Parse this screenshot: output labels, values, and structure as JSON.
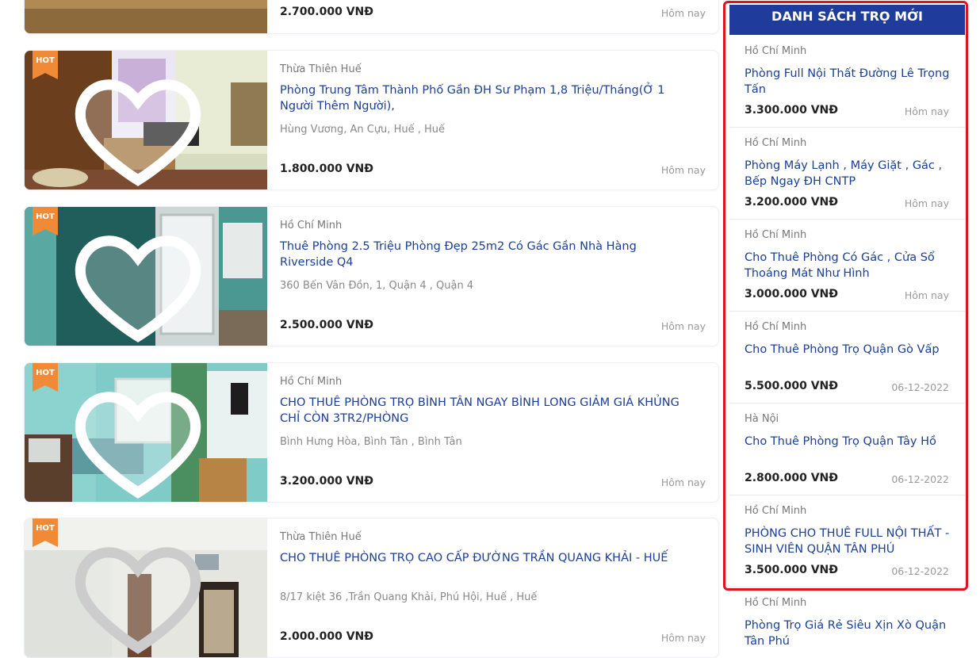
{
  "listings": [
    {
      "region": "",
      "title": "",
      "address": "",
      "price": "2.700.000 VNĐ",
      "date": "Hôm nay",
      "hot": false
    },
    {
      "region": "Thừa Thiên Huế",
      "title": "Phòng Trung Tâm Thành Phố Gần ĐH Sư Phạm 1,8 Triệu/Tháng(Ở 1 Người Thêm Người),",
      "address": "Hùng Vương, An Cựu, Huế , Huế",
      "price": "1.800.000 VNĐ",
      "date": "Hôm nay",
      "hot": true,
      "hot_label": "HOT"
    },
    {
      "region": "Hồ Chí Minh",
      "title": "Thuê Phòng 2.5 Triệu Phòng Đẹp 25m2 Có Gác Gần Nhà Hàng Riverside Q4",
      "address": "360 Bến Vân Đồn, 1, Quận 4 , Quận 4",
      "price": "2.500.000 VNĐ",
      "date": "Hôm nay",
      "hot": true,
      "hot_label": "HOT"
    },
    {
      "region": "Hồ Chí Minh",
      "title": "CHO THUÊ PHÒNG TRỌ BÌNH TÂN NGAY BÌNH LONG GIẢM GIÁ KHỦNG CHỈ CÒN 3TR2/PHÒNG",
      "address": "Bình Hưng Hòa, Bình Tân , Bình Tân",
      "price": "3.200.000 VNĐ",
      "date": "Hôm nay",
      "hot": true,
      "hot_label": "HOT"
    },
    {
      "region": "Thừa Thiên Huế",
      "title": "CHO THUÊ PHÒNG TRỌ CAO CẤP ĐƯỜNG TRẦN QUANG KHẢI - HUẾ",
      "address": "8/17 kiệt 36 ,Trần Quang Khải, Phú Hội, Huế , Huế",
      "price": "2.000.000 VNĐ",
      "date": "Hôm nay",
      "hot": true,
      "hot_label": "HOT"
    }
  ],
  "sidebar": {
    "heading": "DANH SÁCH TRỌ MỚI",
    "items": [
      {
        "region": "Hồ Chí Minh",
        "title": "Phòng Full Nội Thất Đường Lê Trọng Tấn",
        "price": "3.300.000 VNĐ",
        "date": "Hôm nay"
      },
      {
        "region": "Hồ Chí Minh",
        "title": "Phòng Máy Lạnh , Máy Giặt , Gác , Bếp Ngay ĐH CNTP",
        "price": "3.200.000 VNĐ",
        "date": "Hôm nay"
      },
      {
        "region": "Hồ Chí Minh",
        "title": "Cho Thuê Phòng Có Gác , Cửa Sổ Thoáng Mát Như Hình",
        "price": "3.000.000 VNĐ",
        "date": "Hôm nay"
      },
      {
        "region": "Hồ Chí Minh",
        "title": "Cho Thuê Phòng Trọ Quận Gò Vấp",
        "price": "5.500.000 VNĐ",
        "date": "06-12-2022"
      },
      {
        "region": "Hà Nội",
        "title": "Cho Thuê Phòng Trọ Quận Tây Hồ",
        "price": "2.800.000 VNĐ",
        "date": "06-12-2022"
      },
      {
        "region": "Hồ Chí Minh",
        "title": "PHÒNG CHO THUÊ FULL NỘI THẤT - SINH VIÊN QUẬN TÂN PHÚ",
        "price": "3.500.000 VNĐ",
        "date": "06-12-2022"
      },
      {
        "region": "Hồ Chí Minh",
        "title": "Phòng Trọ Giá Rẻ Siêu Xịn Xò Quận Tân Phú",
        "price": "",
        "date": ""
      }
    ]
  },
  "colors": {
    "accent": "#1f3c9c",
    "link": "#1a3f96",
    "hot": "#f08a36",
    "highlight": "#e0131f"
  }
}
